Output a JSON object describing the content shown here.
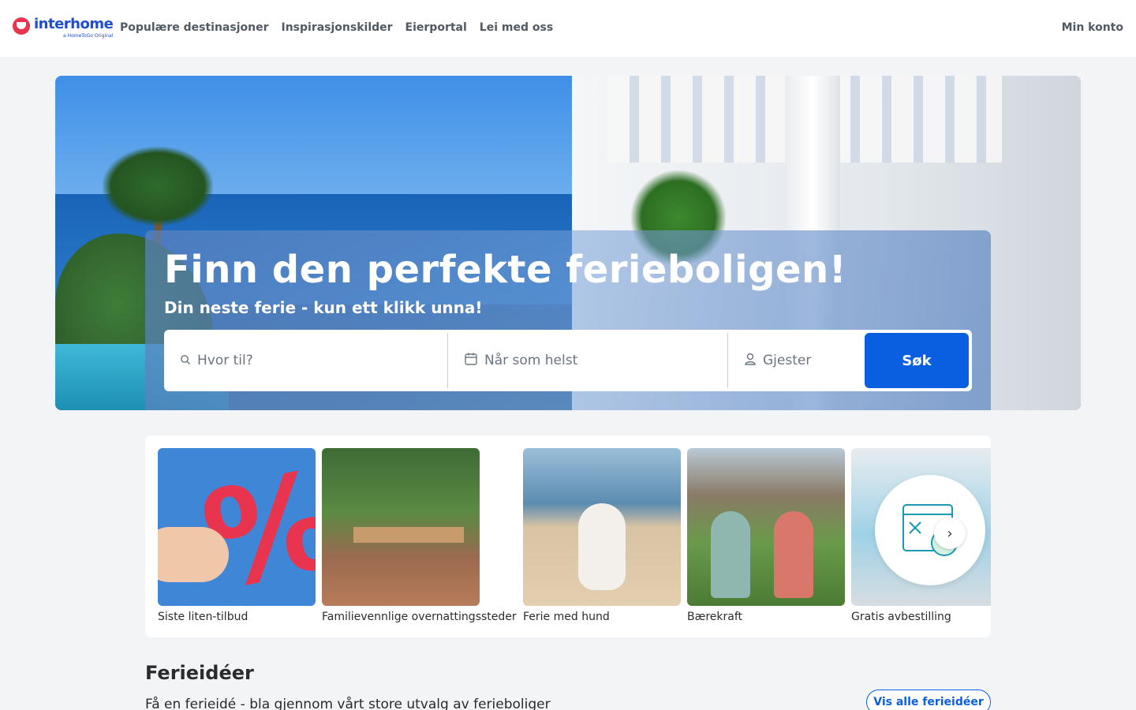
{
  "header": {
    "logo_name": "interhome",
    "logo_sub": "a HomeToGo Original",
    "nav": [
      "Populære destinasjoner",
      "Inspirasjonskilder",
      "Eierportal",
      "Lei med oss"
    ],
    "account": "Min konto"
  },
  "hero": {
    "title": "Finn den perfekte ferieboligen!",
    "subtitle": "Din neste ferie - kun ett klikk unna!",
    "search": {
      "where_placeholder": "Hvor til?",
      "when_value": "Når som helst",
      "guests_placeholder": "Gjester",
      "button": "Søk"
    }
  },
  "categories": [
    {
      "label": "Siste liten-tilbud"
    },
    {
      "label": "Familievennlige overnattingssteder"
    },
    {
      "label": "Ferie med hund"
    },
    {
      "label": "Bærekraft"
    },
    {
      "label": "Gratis avbestilling"
    }
  ],
  "ideas": {
    "title": "Ferieidéer",
    "subtitle": "Få en ferieidé - bla gjennom vårt store utvalg av ferieboliger",
    "button": "Vis alle ferieidéer"
  },
  "colors": {
    "brand_blue": "#0a5fe0",
    "brand_red": "#e8344e"
  }
}
